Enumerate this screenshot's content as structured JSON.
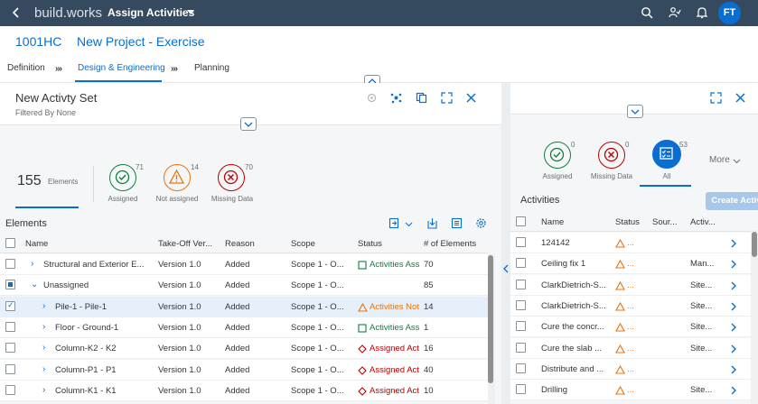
{
  "shell": {
    "brand": "build.works",
    "app_title": "Assign Activities",
    "avatar": "FT",
    "icons": [
      "back-icon",
      "search-icon",
      "people-icon",
      "bell-icon"
    ]
  },
  "object": {
    "id": "1001HC",
    "name": "New Project - Exercise",
    "tabs": [
      "Definition",
      "Design & Engineering",
      "Planning"
    ],
    "selected_tab": "Design & Engineering"
  },
  "left": {
    "title": "New Activty Set",
    "subtitle": "Filtered By None",
    "elements_count": "155",
    "elements_label": "Elements",
    "kpis": [
      {
        "label": "Assigned",
        "count": "71",
        "color": "#107e3e"
      },
      {
        "label": "Not assigned",
        "count": "14",
        "color": "#e9730c"
      },
      {
        "label": "Missing Data",
        "count": "70",
        "color": "#bb0000"
      }
    ],
    "table_title": "Elements",
    "columns": [
      "Name",
      "Take-Off Ver...",
      "Reason",
      "Scope",
      "Status",
      "# of Elements"
    ],
    "rows": [
      {
        "name": "Structural and Exterior E...",
        "version": "Version 1.0",
        "reason": "Added",
        "scope": "Scope 1 - O...",
        "status": "Activities Ass",
        "status_kind": "assigned",
        "count": "70",
        "check": "none",
        "indent": 0,
        "exp": "›"
      },
      {
        "name": "Unassigned",
        "version": "Version 1.0",
        "reason": "Added",
        "scope": "Scope 1 - O...",
        "status": "",
        "status_kind": "",
        "count": "85",
        "check": "partial",
        "indent": 0,
        "exp": "⌄"
      },
      {
        "name": "Pile-1 - Pile-1",
        "version": "Version 1.0",
        "reason": "Added",
        "scope": "Scope 1 - O...",
        "status": "Activities Not",
        "status_kind": "warning",
        "count": "14",
        "check": "checked",
        "indent": 1,
        "exp": "›"
      },
      {
        "name": "Floor - Ground-1",
        "version": "Version 1.0",
        "reason": "Added",
        "scope": "Scope 1 - O...",
        "status": "Activities Ass",
        "status_kind": "assigned",
        "count": "1",
        "check": "none",
        "indent": 1,
        "exp": "›"
      },
      {
        "name": "Column-K2 - K2",
        "version": "Version 1.0",
        "reason": "Added",
        "scope": "Scope 1 - O...",
        "status": "Assigned Act",
        "status_kind": "error",
        "count": "16",
        "check": "none",
        "indent": 1,
        "exp": "›"
      },
      {
        "name": "Column-P1 - P1",
        "version": "Version 1.0",
        "reason": "Added",
        "scope": "Scope 1 - O...",
        "status": "Assigned Act",
        "status_kind": "error",
        "count": "40",
        "check": "none",
        "indent": 1,
        "exp": "›"
      },
      {
        "name": "Column-K1 - K1",
        "version": "Version 1.0",
        "reason": "Added",
        "scope": "Scope 1 - O...",
        "status": "Assigned Act",
        "status_kind": "error",
        "count": "10",
        "check": "none",
        "indent": 1,
        "exp": "›"
      }
    ]
  },
  "right": {
    "kpis": [
      {
        "label": "Assigned",
        "count": "0",
        "color": "#107e3e"
      },
      {
        "label": "Missing Data",
        "count": "0",
        "color": "#bb0000"
      },
      {
        "label": "All",
        "count": "53",
        "color": "#0a6ed1"
      }
    ],
    "more_label": "More",
    "table_title": "Activities",
    "create_label": "Create Activity",
    "columns": [
      "Name",
      "Status",
      "Sour...",
      "Activ..."
    ],
    "rows": [
      {
        "name": "124142",
        "status": "...",
        "source": "",
        "activ": ""
      },
      {
        "name": "Ceiling fix 1",
        "status": "...",
        "source": "",
        "activ": "Man..."
      },
      {
        "name": "ClarkDietrich-S...",
        "status": "...",
        "source": "",
        "activ": "Site..."
      },
      {
        "name": "ClarkDietrich-S...",
        "status": "...",
        "source": "",
        "activ": "Site..."
      },
      {
        "name": "Cure the concr...",
        "status": "...",
        "source": "",
        "activ": "Site..."
      },
      {
        "name": "Cure the slab ...",
        "status": "...",
        "source": "",
        "activ": "Site..."
      },
      {
        "name": "Distribute and ...",
        "status": "...",
        "source": "",
        "activ": ""
      },
      {
        "name": "Drilling",
        "status": "...",
        "source": "",
        "activ": "Site..."
      }
    ]
  }
}
